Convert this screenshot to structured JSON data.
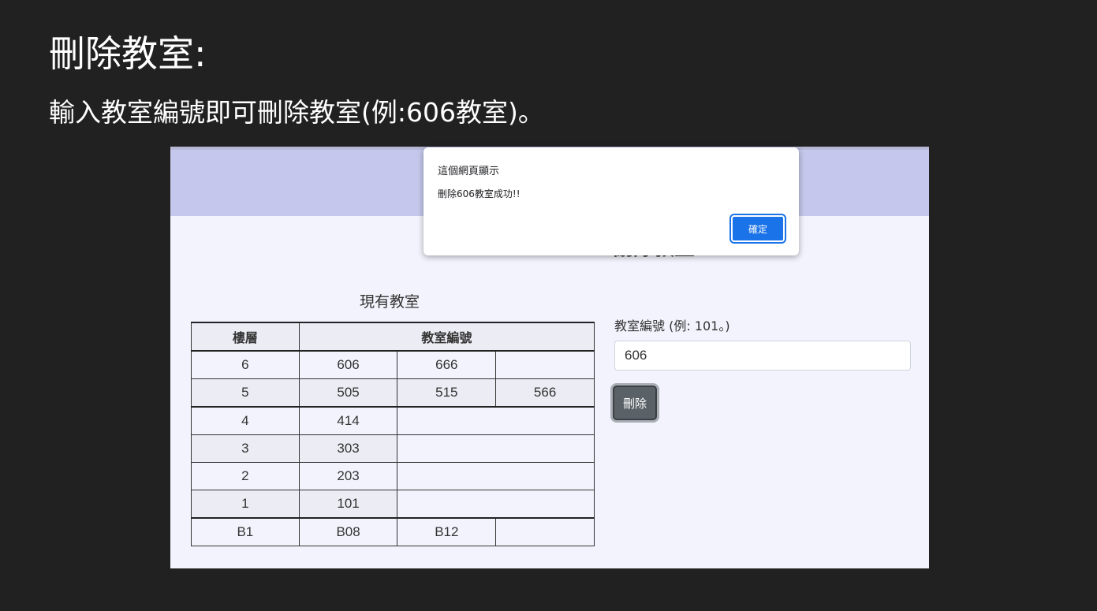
{
  "slide": {
    "title": "刪除教室:",
    "description": "輸入教室編號即可刪除教室(例:606教室)。"
  },
  "page": {
    "heading": "刪除教室",
    "table_caption": "現有教室",
    "table": {
      "headers": [
        "樓層",
        "教室編號"
      ],
      "rows": [
        {
          "floor": "6",
          "rooms": [
            "606",
            "666",
            ""
          ]
        },
        {
          "floor": "5",
          "rooms": [
            "505",
            "515",
            "566"
          ]
        },
        {
          "floor": "4",
          "rooms": [
            "414"
          ]
        },
        {
          "floor": "3",
          "rooms": [
            "303"
          ]
        },
        {
          "floor": "2",
          "rooms": [
            "203"
          ]
        },
        {
          "floor": "1",
          "rooms": [
            "101"
          ]
        },
        {
          "floor": "B1",
          "rooms": [
            "B08",
            "B12",
            ""
          ]
        }
      ]
    },
    "form": {
      "label": "教室編號 (例: 101。)",
      "input_value": "606",
      "delete_button": "刪除"
    }
  },
  "dialog": {
    "title": "這個網頁顯示",
    "message": "刪除606教室成功!!",
    "ok_button": "確定"
  },
  "colors": {
    "slide_background": "#212121",
    "banner": "#c5c7ec",
    "page_background": "#f3f3fd",
    "ok_button": "#1a73e8",
    "delete_button": "#5a6268"
  }
}
